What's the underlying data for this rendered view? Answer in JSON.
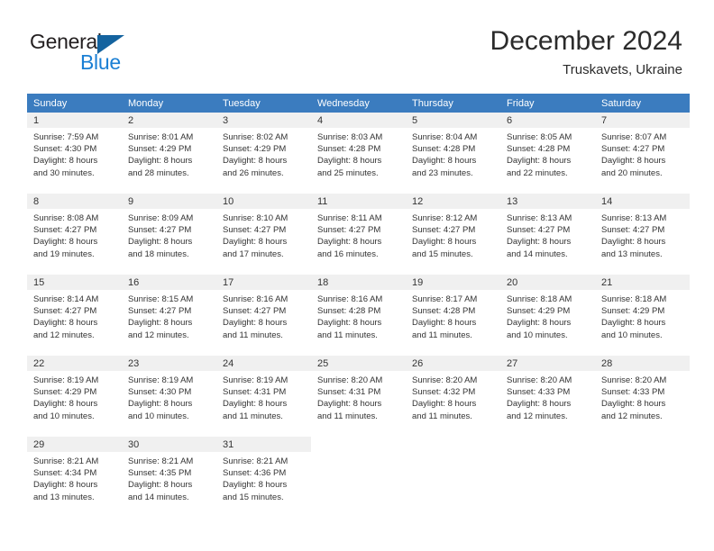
{
  "brand": {
    "name_part1": "General",
    "name_part2": "Blue",
    "logo_icon": "triangle-logo-icon"
  },
  "header": {
    "title": "December 2024",
    "subtitle": "Truskavets, Ukraine"
  },
  "colors": {
    "header_blue": "#3b7cbf",
    "brand_blue": "#1a7fd4",
    "logo_dark_blue": "#14639f",
    "daynum_bg": "#f0f0f0",
    "text": "#333333"
  },
  "weekdays": [
    "Sunday",
    "Monday",
    "Tuesday",
    "Wednesday",
    "Thursday",
    "Friday",
    "Saturday"
  ],
  "labels": {
    "sunrise_prefix": "Sunrise:",
    "sunset_prefix": "Sunset:",
    "daylight_prefix": "Daylight:"
  },
  "weeks": [
    [
      {
        "day": "1",
        "sunrise": "Sunrise: 7:59 AM",
        "sunset": "Sunset: 4:30 PM",
        "daylight1": "Daylight: 8 hours",
        "daylight2": "and 30 minutes."
      },
      {
        "day": "2",
        "sunrise": "Sunrise: 8:01 AM",
        "sunset": "Sunset: 4:29 PM",
        "daylight1": "Daylight: 8 hours",
        "daylight2": "and 28 minutes."
      },
      {
        "day": "3",
        "sunrise": "Sunrise: 8:02 AM",
        "sunset": "Sunset: 4:29 PM",
        "daylight1": "Daylight: 8 hours",
        "daylight2": "and 26 minutes."
      },
      {
        "day": "4",
        "sunrise": "Sunrise: 8:03 AM",
        "sunset": "Sunset: 4:28 PM",
        "daylight1": "Daylight: 8 hours",
        "daylight2": "and 25 minutes."
      },
      {
        "day": "5",
        "sunrise": "Sunrise: 8:04 AM",
        "sunset": "Sunset: 4:28 PM",
        "daylight1": "Daylight: 8 hours",
        "daylight2": "and 23 minutes."
      },
      {
        "day": "6",
        "sunrise": "Sunrise: 8:05 AM",
        "sunset": "Sunset: 4:28 PM",
        "daylight1": "Daylight: 8 hours",
        "daylight2": "and 22 minutes."
      },
      {
        "day": "7",
        "sunrise": "Sunrise: 8:07 AM",
        "sunset": "Sunset: 4:27 PM",
        "daylight1": "Daylight: 8 hours",
        "daylight2": "and 20 minutes."
      }
    ],
    [
      {
        "day": "8",
        "sunrise": "Sunrise: 8:08 AM",
        "sunset": "Sunset: 4:27 PM",
        "daylight1": "Daylight: 8 hours",
        "daylight2": "and 19 minutes."
      },
      {
        "day": "9",
        "sunrise": "Sunrise: 8:09 AM",
        "sunset": "Sunset: 4:27 PM",
        "daylight1": "Daylight: 8 hours",
        "daylight2": "and 18 minutes."
      },
      {
        "day": "10",
        "sunrise": "Sunrise: 8:10 AM",
        "sunset": "Sunset: 4:27 PM",
        "daylight1": "Daylight: 8 hours",
        "daylight2": "and 17 minutes."
      },
      {
        "day": "11",
        "sunrise": "Sunrise: 8:11 AM",
        "sunset": "Sunset: 4:27 PM",
        "daylight1": "Daylight: 8 hours",
        "daylight2": "and 16 minutes."
      },
      {
        "day": "12",
        "sunrise": "Sunrise: 8:12 AM",
        "sunset": "Sunset: 4:27 PM",
        "daylight1": "Daylight: 8 hours",
        "daylight2": "and 15 minutes."
      },
      {
        "day": "13",
        "sunrise": "Sunrise: 8:13 AM",
        "sunset": "Sunset: 4:27 PM",
        "daylight1": "Daylight: 8 hours",
        "daylight2": "and 14 minutes."
      },
      {
        "day": "14",
        "sunrise": "Sunrise: 8:13 AM",
        "sunset": "Sunset: 4:27 PM",
        "daylight1": "Daylight: 8 hours",
        "daylight2": "and 13 minutes."
      }
    ],
    [
      {
        "day": "15",
        "sunrise": "Sunrise: 8:14 AM",
        "sunset": "Sunset: 4:27 PM",
        "daylight1": "Daylight: 8 hours",
        "daylight2": "and 12 minutes."
      },
      {
        "day": "16",
        "sunrise": "Sunrise: 8:15 AM",
        "sunset": "Sunset: 4:27 PM",
        "daylight1": "Daylight: 8 hours",
        "daylight2": "and 12 minutes."
      },
      {
        "day": "17",
        "sunrise": "Sunrise: 8:16 AM",
        "sunset": "Sunset: 4:27 PM",
        "daylight1": "Daylight: 8 hours",
        "daylight2": "and 11 minutes."
      },
      {
        "day": "18",
        "sunrise": "Sunrise: 8:16 AM",
        "sunset": "Sunset: 4:28 PM",
        "daylight1": "Daylight: 8 hours",
        "daylight2": "and 11 minutes."
      },
      {
        "day": "19",
        "sunrise": "Sunrise: 8:17 AM",
        "sunset": "Sunset: 4:28 PM",
        "daylight1": "Daylight: 8 hours",
        "daylight2": "and 11 minutes."
      },
      {
        "day": "20",
        "sunrise": "Sunrise: 8:18 AM",
        "sunset": "Sunset: 4:29 PM",
        "daylight1": "Daylight: 8 hours",
        "daylight2": "and 10 minutes."
      },
      {
        "day": "21",
        "sunrise": "Sunrise: 8:18 AM",
        "sunset": "Sunset: 4:29 PM",
        "daylight1": "Daylight: 8 hours",
        "daylight2": "and 10 minutes."
      }
    ],
    [
      {
        "day": "22",
        "sunrise": "Sunrise: 8:19 AM",
        "sunset": "Sunset: 4:29 PM",
        "daylight1": "Daylight: 8 hours",
        "daylight2": "and 10 minutes."
      },
      {
        "day": "23",
        "sunrise": "Sunrise: 8:19 AM",
        "sunset": "Sunset: 4:30 PM",
        "daylight1": "Daylight: 8 hours",
        "daylight2": "and 10 minutes."
      },
      {
        "day": "24",
        "sunrise": "Sunrise: 8:19 AM",
        "sunset": "Sunset: 4:31 PM",
        "daylight1": "Daylight: 8 hours",
        "daylight2": "and 11 minutes."
      },
      {
        "day": "25",
        "sunrise": "Sunrise: 8:20 AM",
        "sunset": "Sunset: 4:31 PM",
        "daylight1": "Daylight: 8 hours",
        "daylight2": "and 11 minutes."
      },
      {
        "day": "26",
        "sunrise": "Sunrise: 8:20 AM",
        "sunset": "Sunset: 4:32 PM",
        "daylight1": "Daylight: 8 hours",
        "daylight2": "and 11 minutes."
      },
      {
        "day": "27",
        "sunrise": "Sunrise: 8:20 AM",
        "sunset": "Sunset: 4:33 PM",
        "daylight1": "Daylight: 8 hours",
        "daylight2": "and 12 minutes."
      },
      {
        "day": "28",
        "sunrise": "Sunrise: 8:20 AM",
        "sunset": "Sunset: 4:33 PM",
        "daylight1": "Daylight: 8 hours",
        "daylight2": "and 12 minutes."
      }
    ],
    [
      {
        "day": "29",
        "sunrise": "Sunrise: 8:21 AM",
        "sunset": "Sunset: 4:34 PM",
        "daylight1": "Daylight: 8 hours",
        "daylight2": "and 13 minutes."
      },
      {
        "day": "30",
        "sunrise": "Sunrise: 8:21 AM",
        "sunset": "Sunset: 4:35 PM",
        "daylight1": "Daylight: 8 hours",
        "daylight2": "and 14 minutes."
      },
      {
        "day": "31",
        "sunrise": "Sunrise: 8:21 AM",
        "sunset": "Sunset: 4:36 PM",
        "daylight1": "Daylight: 8 hours",
        "daylight2": "and 15 minutes."
      },
      {
        "day": "",
        "sunrise": "",
        "sunset": "",
        "daylight1": "",
        "daylight2": ""
      },
      {
        "day": "",
        "sunrise": "",
        "sunset": "",
        "daylight1": "",
        "daylight2": ""
      },
      {
        "day": "",
        "sunrise": "",
        "sunset": "",
        "daylight1": "",
        "daylight2": ""
      },
      {
        "day": "",
        "sunrise": "",
        "sunset": "",
        "daylight1": "",
        "daylight2": ""
      }
    ]
  ]
}
